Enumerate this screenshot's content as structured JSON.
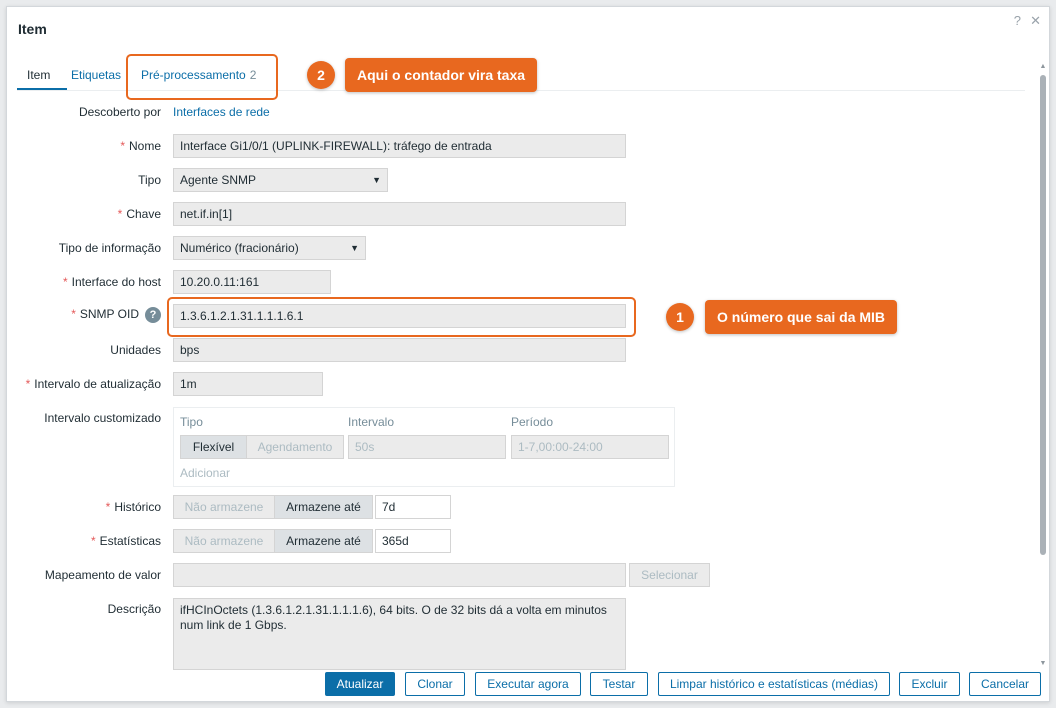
{
  "dialog": {
    "title": "Item",
    "help_icon": "?",
    "close_icon": "✕"
  },
  "tabs": [
    {
      "label": "Item"
    },
    {
      "label": "Etiquetas"
    },
    {
      "label": "Pré-processamento",
      "count": "2"
    }
  ],
  "callouts": [
    {
      "number": "1",
      "text": "O número que sai da MIB"
    },
    {
      "number": "2",
      "text": "Aqui o contador vira taxa"
    }
  ],
  "form": {
    "discovered_by_label": "Descoberto por",
    "discovered_by_link": "Interfaces de rede",
    "name_label": "Nome",
    "name_value": "Interface Gi1/0/1 (UPLINK-FIREWALL): tráfego de entrada",
    "type_label": "Tipo",
    "type_value": "Agente SNMP",
    "key_label": "Chave",
    "key_value": "net.if.in[1]",
    "info_type_label": "Tipo de informação",
    "info_type_value": "Numérico (fracionário)",
    "host_interface_label": "Interface do host",
    "host_interface_value": "10.20.0.11:161",
    "snmp_oid_label": "SNMP OID",
    "snmp_oid_value": "1.3.6.1.2.1.31.1.1.1.6.1",
    "units_label": "Unidades",
    "units_value": "bps",
    "update_interval_label": "Intervalo de atualização",
    "update_interval_value": "1m",
    "custom_interval_label": "Intervalo customizado",
    "custom_interval": {
      "col_type": "Tipo",
      "col_interval": "Intervalo",
      "col_period": "Período",
      "type_flexible": "Flexível",
      "type_scheduling": "Agendamento",
      "interval_value": "50s",
      "period_value": "1-7,00:00-24:00",
      "add_label": "Adicionar"
    },
    "history_label": "Histórico",
    "history_no_store": "Não armazene",
    "history_store_until": "Armazene até",
    "history_value": "7d",
    "trends_label": "Estatísticas",
    "trends_no_store": "Não armazene",
    "trends_store_until": "Armazene até",
    "trends_value": "365d",
    "value_mapping_label": "Mapeamento de valor",
    "value_mapping_select": "Selecionar",
    "description_label": "Descrição",
    "description_value": "ifHCInOctets (1.3.6.1.2.1.31.1.1.1.6), 64 bits. O de 32 bits dá a volta em minutos num link de 1 Gbps."
  },
  "footer": {
    "update": "Atualizar",
    "clone": "Clonar",
    "execute_now": "Executar agora",
    "test": "Testar",
    "clear_history": "Limpar histórico e estatísticas (médias)",
    "delete": "Excluir",
    "cancel": "Cancelar"
  },
  "colors": {
    "accent": "#0b6ea8",
    "callout": "#e8681f",
    "required": "#e45959"
  }
}
